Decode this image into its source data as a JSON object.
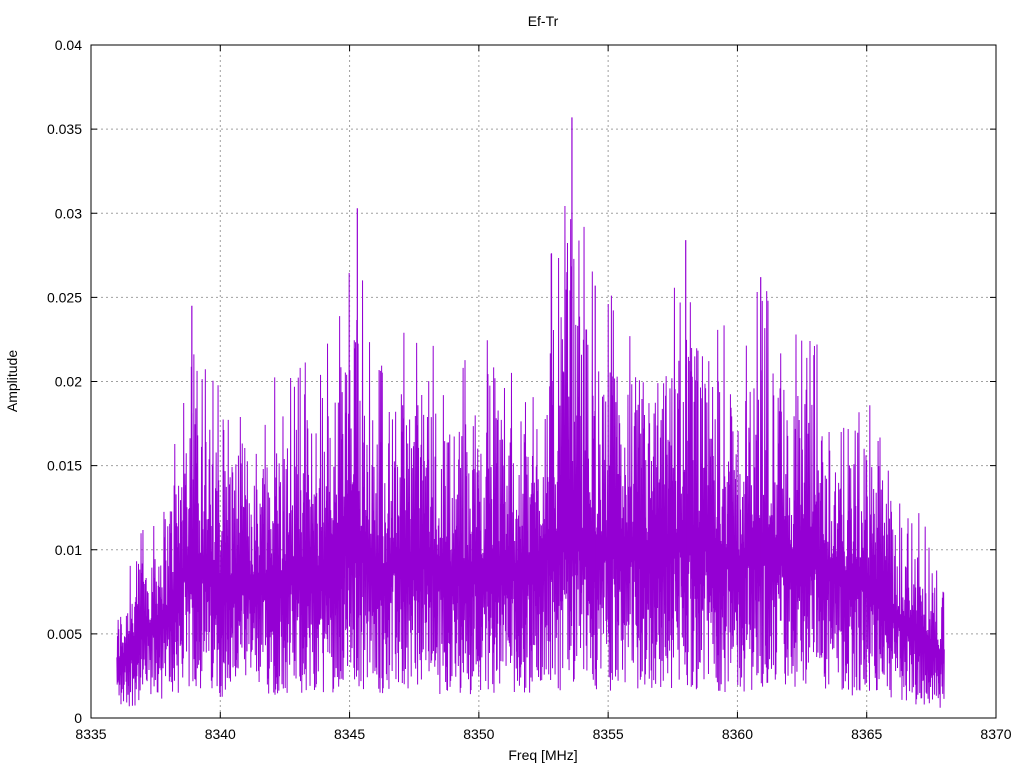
{
  "chart_data": {
    "type": "line",
    "title": "Ef-Tr",
    "xlabel": "Freq [MHz]",
    "ylabel": "Amplitude",
    "xlim": [
      8335,
      8370
    ],
    "ylim": [
      0,
      0.04
    ],
    "xticks": [
      8335,
      8340,
      8345,
      8350,
      8355,
      8360,
      8365,
      8370
    ],
    "xtick_labels": [
      "8335",
      "8340",
      "8345",
      "8350",
      "8355",
      "8360",
      "8365",
      "8370"
    ],
    "yticks": [
      0,
      0.005,
      0.01,
      0.015,
      0.02,
      0.025,
      0.03,
      0.035,
      0.04
    ],
    "ytick_labels": [
      "0",
      "0.005",
      "0.01",
      "0.015",
      "0.02",
      "0.025",
      "0.03",
      "0.035",
      "0.04"
    ],
    "grid": true,
    "legend": "none",
    "colors": {
      "series": "#9400d3",
      "grid": "#a0a0a0",
      "frame": "#000000"
    },
    "series": [
      {
        "x_range": [
          8336,
          8368
        ],
        "envelope_max": [
          [
            8336.0,
            0.0075
          ],
          [
            8337.0,
            0.0125
          ],
          [
            8338.0,
            0.016
          ],
          [
            8338.9,
            0.0245
          ],
          [
            8340.0,
            0.0195
          ],
          [
            8342.0,
            0.0205
          ],
          [
            8343.0,
            0.0215
          ],
          [
            8344.0,
            0.0215
          ],
          [
            8345.3,
            0.0303
          ],
          [
            8346.0,
            0.021
          ],
          [
            8347.0,
            0.0235
          ],
          [
            8348.0,
            0.0235
          ],
          [
            8349.0,
            0.021
          ],
          [
            8350.0,
            0.0225
          ],
          [
            8351.0,
            0.0225
          ],
          [
            8352.0,
            0.021
          ],
          [
            8352.8,
            0.0276
          ],
          [
            8353.6,
            0.0357
          ],
          [
            8354.5,
            0.0257
          ],
          [
            8355.5,
            0.025
          ],
          [
            8357.0,
            0.0245
          ],
          [
            8358.0,
            0.0284
          ],
          [
            8359.0,
            0.026
          ],
          [
            8360.0,
            0.0225
          ],
          [
            8360.9,
            0.0262
          ],
          [
            8362.0,
            0.024
          ],
          [
            8363.0,
            0.0235
          ],
          [
            8364.0,
            0.021
          ],
          [
            8365.0,
            0.0205
          ],
          [
            8366.0,
            0.0155
          ],
          [
            8367.0,
            0.0125
          ],
          [
            8368.0,
            0.009
          ]
        ],
        "typical_band": [
          0.003,
          0.011
        ],
        "peaks": [
          [
            8338.9,
            0.0245
          ],
          [
            8345.3,
            0.0303
          ],
          [
            8352.8,
            0.0276
          ],
          [
            8353.6,
            0.0357
          ],
          [
            8354.5,
            0.0257
          ],
          [
            8358.0,
            0.0284
          ],
          [
            8360.9,
            0.0262
          ]
        ]
      }
    ]
  }
}
